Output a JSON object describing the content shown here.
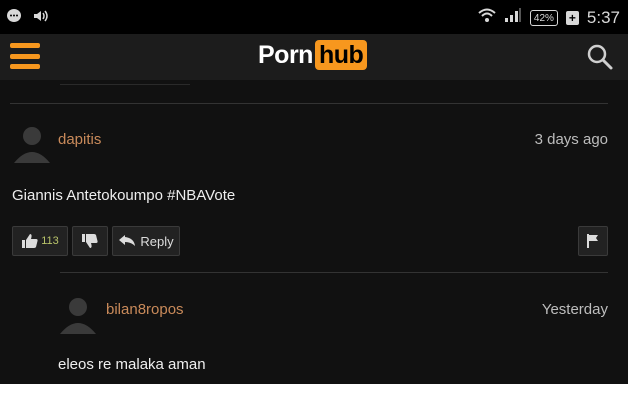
{
  "status_bar": {
    "battery": "42%",
    "time": "5:37"
  },
  "header": {
    "logo_part1": "Porn",
    "logo_part2": "hub"
  },
  "comments": [
    {
      "username": "dapitis",
      "timestamp": "3 days ago",
      "text": "Giannis Antetokoumpo #NBAVote",
      "likes": "113",
      "reply_label": "Reply"
    },
    {
      "username": "bilan8ropos",
      "timestamp": "Yesterday",
      "text": "eleos re malaka aman"
    }
  ],
  "colors": {
    "accent": "#f7971e",
    "username": "#c98a5a",
    "background": "#111111"
  }
}
